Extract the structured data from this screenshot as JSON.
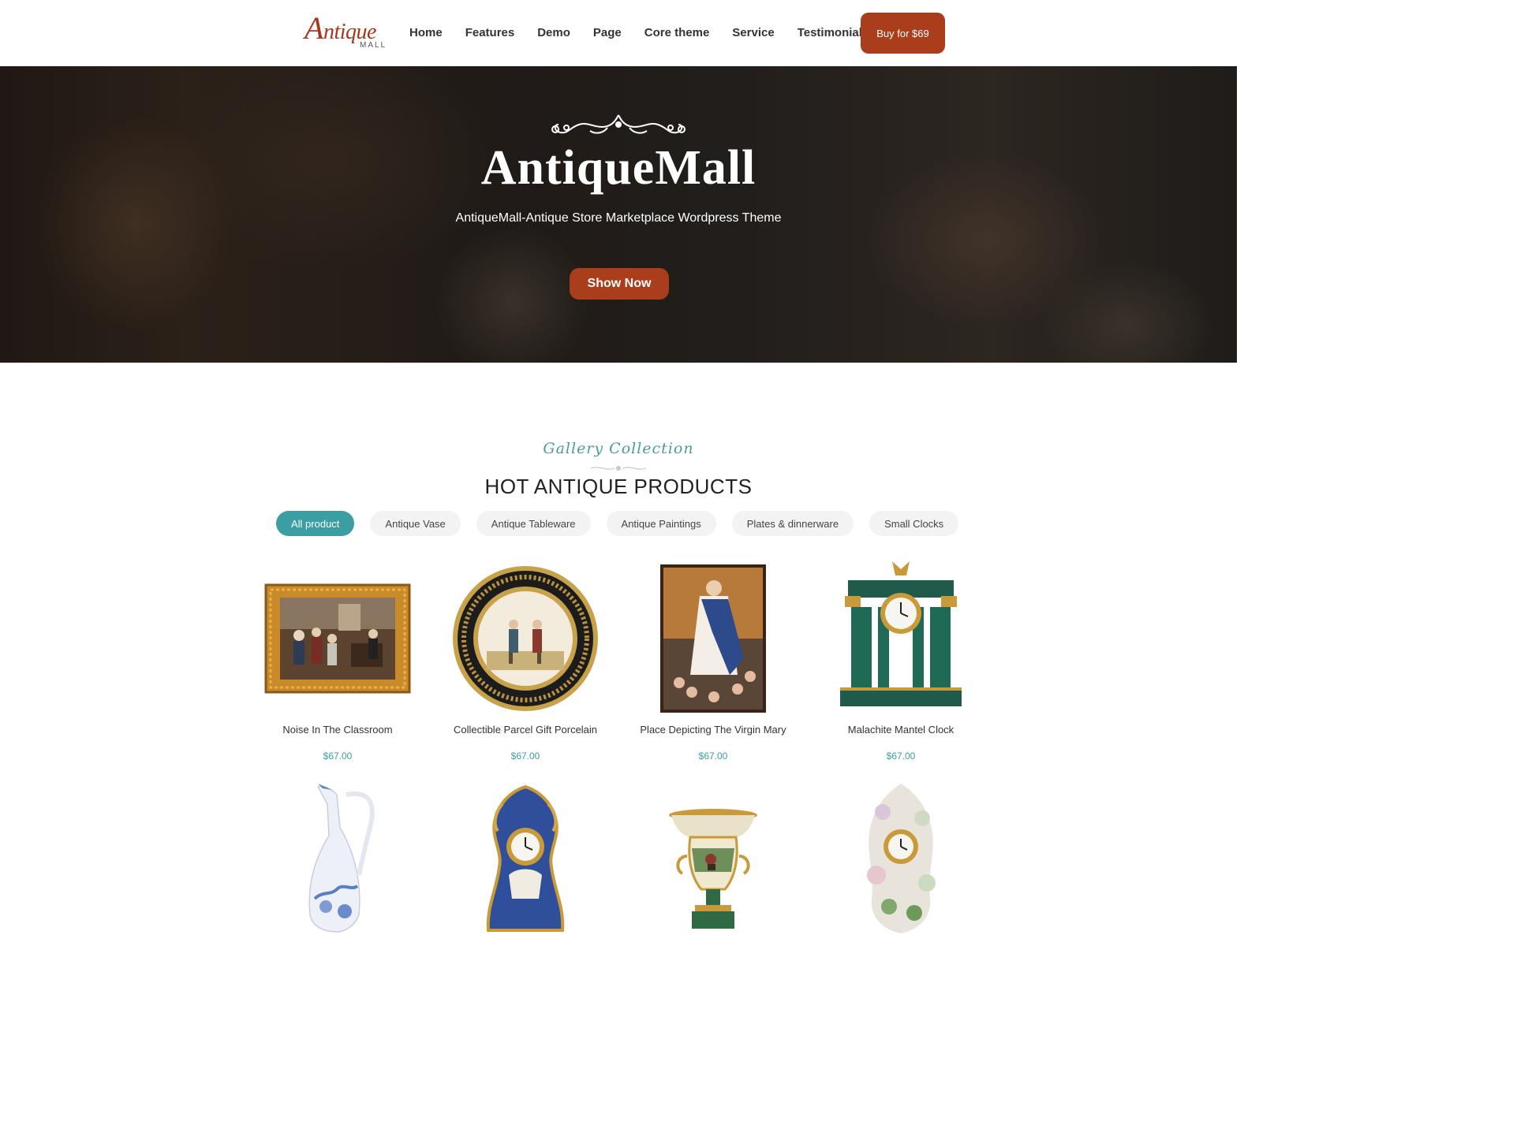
{
  "logo": {
    "letter": "A",
    "rest": "ntique",
    "sub": "MALL"
  },
  "nav": [
    {
      "label": "Home"
    },
    {
      "label": "Features"
    },
    {
      "label": "Demo"
    },
    {
      "label": "Page"
    },
    {
      "label": "Core theme"
    },
    {
      "label": "Service"
    },
    {
      "label": "Testimonials"
    }
  ],
  "buy_button": "Buy for $69",
  "hero": {
    "title": "AntiqueMall",
    "subtitle": "AntiqueMall-Antique Store Marketplace Wordpress Theme",
    "button": "Show Now"
  },
  "gallery": {
    "script_title": "Gallery Collection",
    "heading": "HOT ANTIQUE PRODUCTS",
    "filters": [
      {
        "label": "All product",
        "active": true
      },
      {
        "label": "Antique Vase"
      },
      {
        "label": "Antique Tableware"
      },
      {
        "label": "Antique Paintings"
      },
      {
        "label": "Plates & dinnerware"
      },
      {
        "label": "Small Clocks"
      }
    ]
  },
  "products": [
    {
      "name": "Noise In The Classroom",
      "price": "$67.00",
      "image": "framed-painting"
    },
    {
      "name": "Collectible Parcel Gift Porcelain",
      "price": "$67.00",
      "image": "porcelain-plate"
    },
    {
      "name": "Place Depicting The Virgin Mary",
      "price": "$67.00",
      "image": "religious-painting"
    },
    {
      "name": "Malachite Mantel Clock",
      "price": "$67.00",
      "image": "malachite-clock"
    },
    {
      "name": "",
      "price": "",
      "image": "glass-pitcher"
    },
    {
      "name": "",
      "price": "",
      "image": "rococo-clock"
    },
    {
      "name": "",
      "price": "",
      "image": "urn-vase"
    },
    {
      "name": "",
      "price": "",
      "image": "porcelain-floral-clock"
    }
  ]
}
